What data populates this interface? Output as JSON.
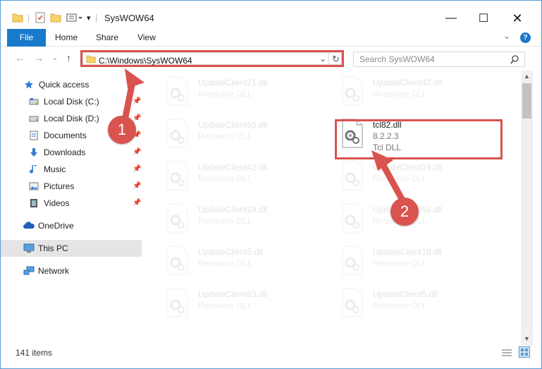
{
  "window": {
    "title": "SysWOW64"
  },
  "ribbon": {
    "tabs": [
      "File",
      "Home",
      "Share",
      "View"
    ],
    "help": "?"
  },
  "nav": {
    "address": "C:\\Windows\\SysWOW64",
    "search_placeholder": "Search SysWOW64"
  },
  "sidebar": {
    "items": [
      {
        "label": "Quick access",
        "icon": "star-icon",
        "pinned": false
      },
      {
        "label": "Local Disk (C:)",
        "icon": "drive-icon",
        "pinned": true
      },
      {
        "label": "Local Disk (D:)",
        "icon": "drive-icon",
        "pinned": true
      },
      {
        "label": "Documents",
        "icon": "documents-icon",
        "pinned": true
      },
      {
        "label": "Downloads",
        "icon": "download-icon",
        "pinned": true
      },
      {
        "label": "Music",
        "icon": "music-icon",
        "pinned": true
      },
      {
        "label": "Pictures",
        "icon": "pictures-icon",
        "pinned": true
      },
      {
        "label": "Videos",
        "icon": "videos-icon",
        "pinned": true
      },
      {
        "label": "OneDrive",
        "icon": "cloud-icon",
        "pinned": false
      },
      {
        "label": "This PC",
        "icon": "computer-icon",
        "pinned": false
      },
      {
        "label": "Network",
        "icon": "network-icon",
        "pinned": false
      }
    ]
  },
  "files": {
    "left": [
      {
        "name": "UpdateClient21.dll",
        "type": "Resource DLL"
      },
      {
        "name": "UpdateClient65.dll",
        "type": "Resource DLL"
      },
      {
        "name": "UpdateClient42.dll",
        "type": "Resource DLL"
      },
      {
        "name": "UpdateClient19.dll",
        "type": "Resource DLL"
      },
      {
        "name": "UpdateClient5.dll",
        "type": "Resource DLL"
      },
      {
        "name": "UpdateClient63.dll",
        "type": "Resource DLL"
      }
    ],
    "right": [
      {
        "name": "UpdateClient42.dll",
        "type": "Resource DLL"
      },
      {
        "name": "tcl82.dll",
        "version": "8.2.2.3",
        "type": "Tcl DLL",
        "highlighted": true
      },
      {
        "name": "UpdateClient19.dll",
        "type": "Resource DLL"
      },
      {
        "name": "UpdateClient65.dll",
        "type": "Resource DLL"
      },
      {
        "name": "UpdateClient19.dll",
        "type": "Resource DLL"
      },
      {
        "name": "UpdateClient5.dll",
        "type": "Resource DLL"
      }
    ]
  },
  "status": {
    "item_count": "141 items"
  },
  "annotations": {
    "step1": "1",
    "step2": "2",
    "color": "#d9534f"
  }
}
